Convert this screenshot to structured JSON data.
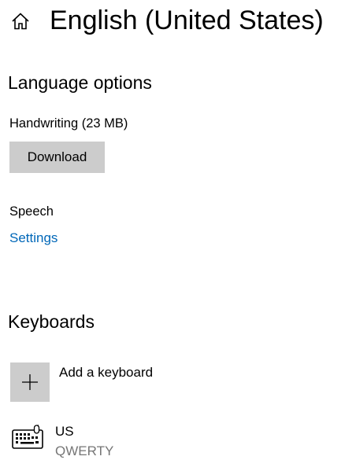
{
  "header": {
    "home_icon": "home-icon",
    "title": "English (United States)"
  },
  "language_options": {
    "heading": "Language options",
    "handwriting": {
      "label": "Handwriting (23 MB)",
      "download_label": "Download"
    },
    "speech": {
      "label": "Speech",
      "settings_link": "Settings"
    }
  },
  "keyboards": {
    "heading": "Keyboards",
    "add": {
      "icon": "plus-icon",
      "label": "Add a keyboard"
    },
    "items": [
      {
        "icon": "keyboard-icon",
        "name": "US",
        "layout": "QWERTY"
      }
    ]
  },
  "colors": {
    "link": "#0067b8",
    "button_bg": "#cccccc",
    "secondary_text": "#767676"
  }
}
